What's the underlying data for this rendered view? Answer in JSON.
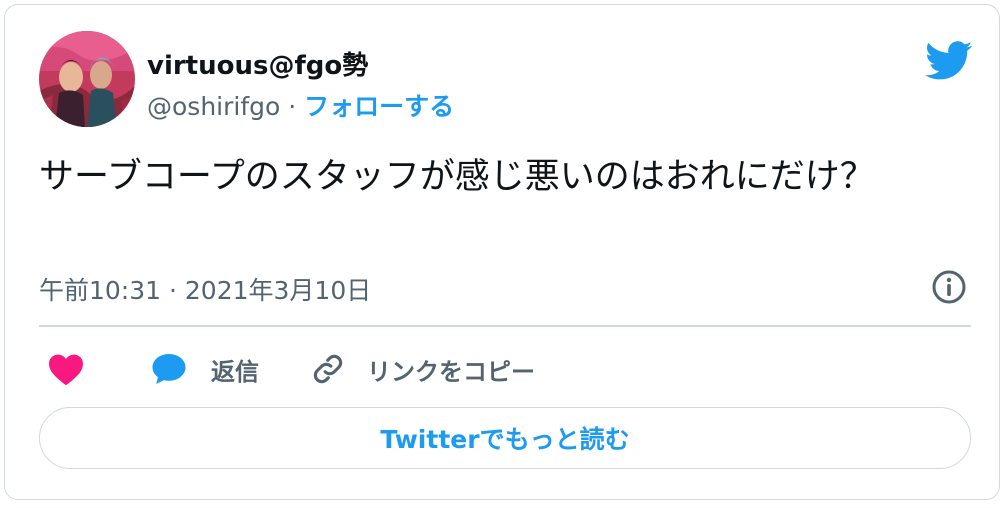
{
  "author": {
    "display_name": "virtuous@fgo勢",
    "handle": "@oshirifgo",
    "separator": " · ",
    "follow_label": "フォローする",
    "avatar": "avatar-image"
  },
  "tweet": {
    "text": "サーブコープのスタッフが感じ悪いのはおれにだけ？",
    "timestamp": "午前10:31 · 2021年3月10日"
  },
  "actions": {
    "like_icon": "heart-icon",
    "reply_icon": "reply-bubble-icon",
    "reply_label": "返信",
    "copy_icon": "link-icon",
    "copy_label": "リンクをコピー"
  },
  "read_more_label": "Twitterでもっと読む",
  "colors": {
    "accent": "#1d9bf0",
    "like": "#f91880",
    "text_primary": "#0f1419",
    "text_secondary": "#536471",
    "border": "#cfd9de"
  }
}
